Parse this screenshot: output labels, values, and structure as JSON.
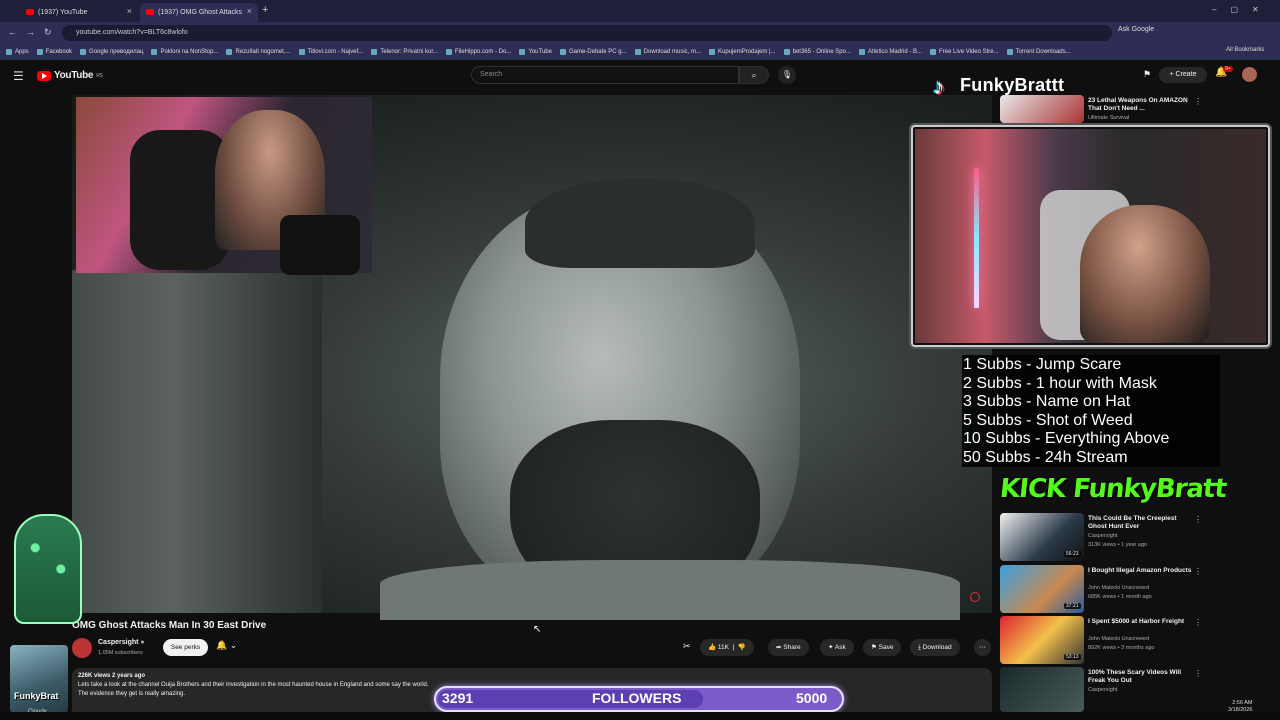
{
  "browser": {
    "tabs": [
      {
        "label": "(1937) YouTube"
      },
      {
        "label": "(1937) OMG Ghost Attacks"
      }
    ],
    "url": "youtube.com/watch?v=BLT6c8wlofo",
    "ask_google": "Ask Google",
    "bookmarks": [
      "Apps",
      "Facebook",
      "Google преводилац",
      "Pokloni na NonStop...",
      "Rezultati nogomet,...",
      "Titlovi.com - Najvef...",
      "Telenor: Privatni kor...",
      "FileHippo.com - Do...",
      "YouTube",
      "Game-Debate PC g...",
      "Download music, m...",
      "KupujemProdajem |...",
      "bet365 - Online Spo...",
      "Atletico Madrid - B...",
      "Free Live Video Stre...",
      "Torrent Downloads..."
    ],
    "all_bookmarks": "All Bookmarks"
  },
  "youtube": {
    "logo": "YouTube",
    "region": "RS",
    "search_placeholder": "Search",
    "create_label": "Create",
    "notif_count": "9+"
  },
  "overlay": {
    "brand_name": "FunkyBrattt",
    "tiktok_glyph": "♪",
    "subs_goals": [
      "1 Subbs - Jump Scare",
      "2 Subbs - 1 hour with Mask",
      "3 Subbs - Name on Hat",
      "5 Subbs - Shot of Weed",
      "10 Subbs - Everything Above",
      "50 Subbs - 24h Stream"
    ],
    "kick_text": "KICK FunkyBratt",
    "followers_current": "3291",
    "followers_label": "FOLLOWERS",
    "followers_goal": "5000",
    "followers_progress": 0.658,
    "pfp_label": "FunkyBrat",
    "weather": "Cloudy"
  },
  "video": {
    "title": "OMG Ghost Attacks Man In 30 East Drive",
    "channel": "Caspersight",
    "channel_subs": "1.05M subscribers",
    "perks_label": "See perks",
    "likes": "11K",
    "share": "Share",
    "ask": "Ask",
    "save": "Save",
    "download": "Download",
    "views_line": "226K views  2 years ago",
    "desc_line1": "Lets take a look at the channel Ouija Brothers and their investigation in the most haunted house in England and some say the world.",
    "desc_line2": "The evidence they get is really amazing."
  },
  "recommendations": [
    {
      "title": "23 Lethal Weapons On AMAZON That Don't Need ...",
      "channel": "Ultimate Survival",
      "meta": "",
      "duration": ""
    },
    {
      "title": "This Could Be The Creepiest Ghost Hunt Ever",
      "channel": "Caspersight",
      "meta": "313K views • 1 year ago",
      "duration": "56:23"
    },
    {
      "title": "I Bought Illegal Amazon Products",
      "channel": "John Malecki Unscrewed",
      "meta": "685K views • 1 month ago",
      "duration": "37:21"
    },
    {
      "title": "I Spent $5000 at Harbor Freight",
      "channel": "John Malecki Unscrewed",
      "meta": "892K views • 3 months ago",
      "duration": "53:13"
    },
    {
      "title": "100% These Scary Videos Will Freak You Out",
      "channel": "Caspersight",
      "meta": "",
      "duration": ""
    }
  ],
  "system": {
    "time": "2:56 AM",
    "date": "3/18/2026"
  }
}
